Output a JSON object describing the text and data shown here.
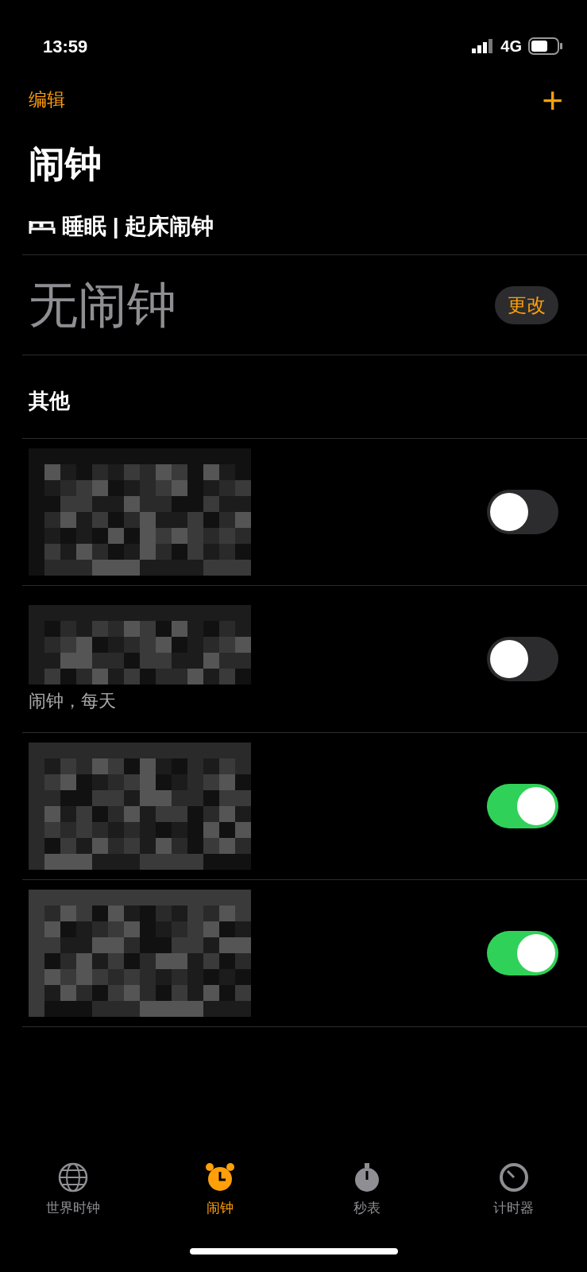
{
  "status_bar": {
    "time": "13:59",
    "network": "4G"
  },
  "nav": {
    "edit": "编辑",
    "add": "+"
  },
  "title": "闹钟",
  "sleep": {
    "header": "睡眠 | 起床闹钟",
    "empty": "无闹钟",
    "change": "更改"
  },
  "others": {
    "header": "其他",
    "alarms": [
      {
        "on": false
      },
      {
        "on": false,
        "label": "闹钟，每天"
      },
      {
        "on": true
      },
      {
        "on": true
      }
    ]
  },
  "tabs": [
    {
      "kind": "globe",
      "label": "世界时钟",
      "selected": false
    },
    {
      "kind": "alarm",
      "label": "闹钟",
      "selected": true
    },
    {
      "kind": "stopwatch",
      "label": "秒表",
      "selected": false
    },
    {
      "kind": "timer",
      "label": "计时器",
      "selected": false
    }
  ]
}
